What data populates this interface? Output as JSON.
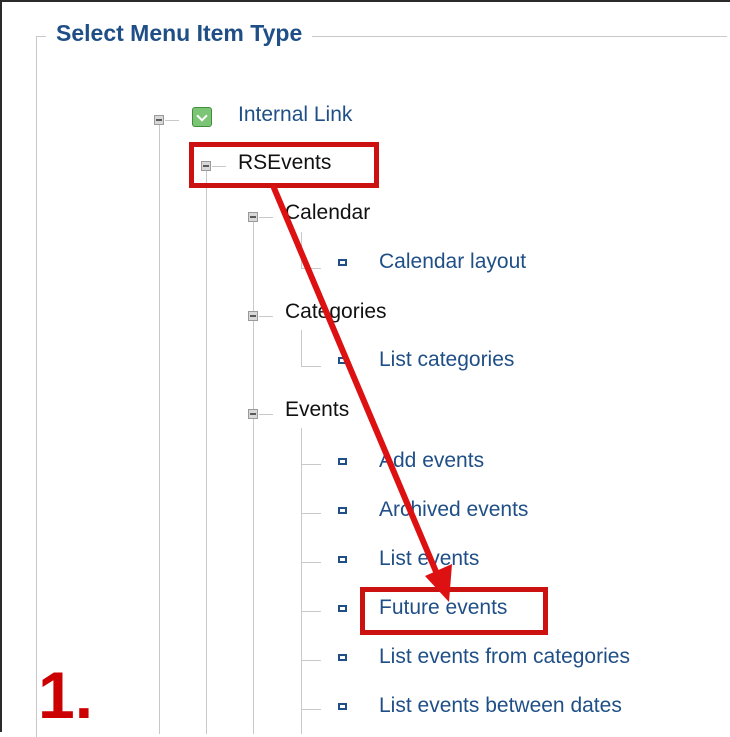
{
  "fieldset": {
    "legend": "Select Menu Item Type"
  },
  "tree": {
    "internal_link": "Internal Link",
    "rsevents": "RSEvents",
    "calendar": {
      "label": "Calendar",
      "items": [
        "Calendar layout"
      ]
    },
    "categories": {
      "label": "Categories",
      "items": [
        "List categories"
      ]
    },
    "events": {
      "label": "Events",
      "items": [
        "Add events",
        "Archived events",
        "List events",
        "Future events",
        "List events from categories",
        "List events between dates"
      ]
    }
  },
  "annotation": {
    "step_number": "1.",
    "highlight_color": "#cc1111",
    "highlight_from": "RSEvents",
    "highlight_to": "Future events"
  },
  "colors": {
    "link": "#1f4f86",
    "heading": "#1f4f86",
    "tree_line": "#c9c9c9"
  }
}
